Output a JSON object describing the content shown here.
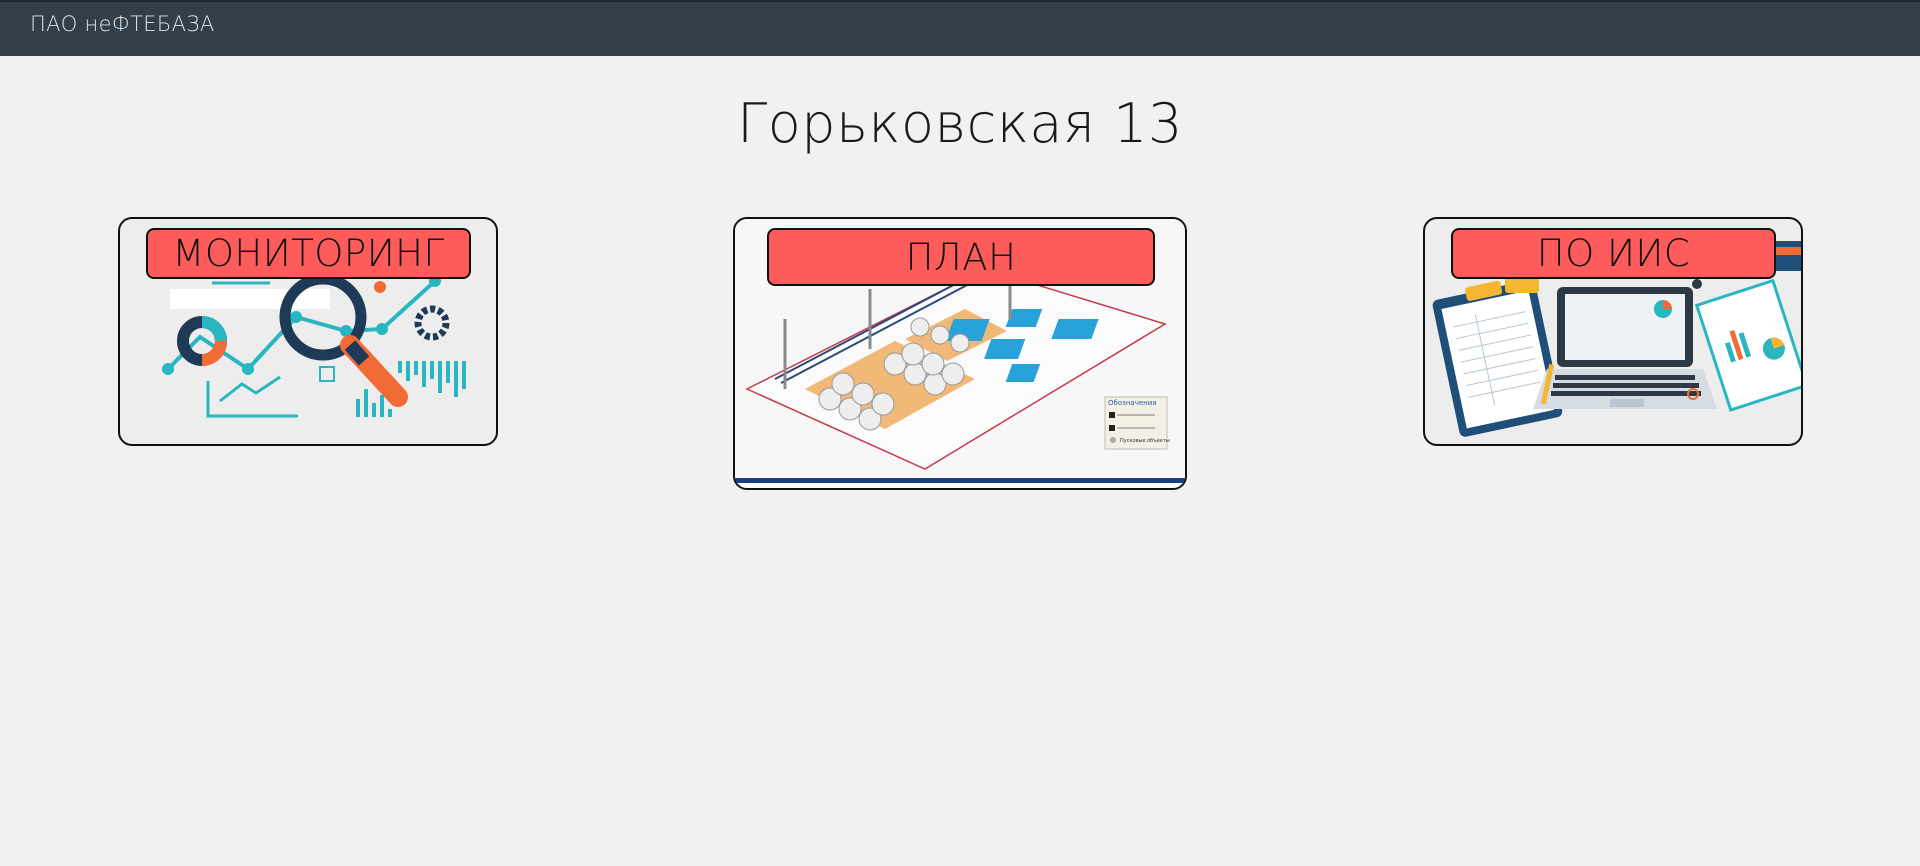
{
  "header": {
    "brand": "ПАО неФТЕБАЗА"
  },
  "page": {
    "title": "Горьковская 13"
  },
  "cards": [
    {
      "label": "МОНИТОРИНГ",
      "illustration": "analytics-magnifier-icon"
    },
    {
      "label": "ПЛАН",
      "illustration": "oil-depot-isometric-plan",
      "legend_title": "Обозначения",
      "legend_item": "Пусковые объекты"
    },
    {
      "label": "ПО ИИС",
      "illustration": "laptop-clipboard-desk-icon"
    }
  ],
  "colors": {
    "topbar": "#333f48",
    "label_bg": "#fd5c5b",
    "accent_teal": "#29b6c1",
    "accent_orange": "#f26a36",
    "navy": "#1f3a56"
  }
}
